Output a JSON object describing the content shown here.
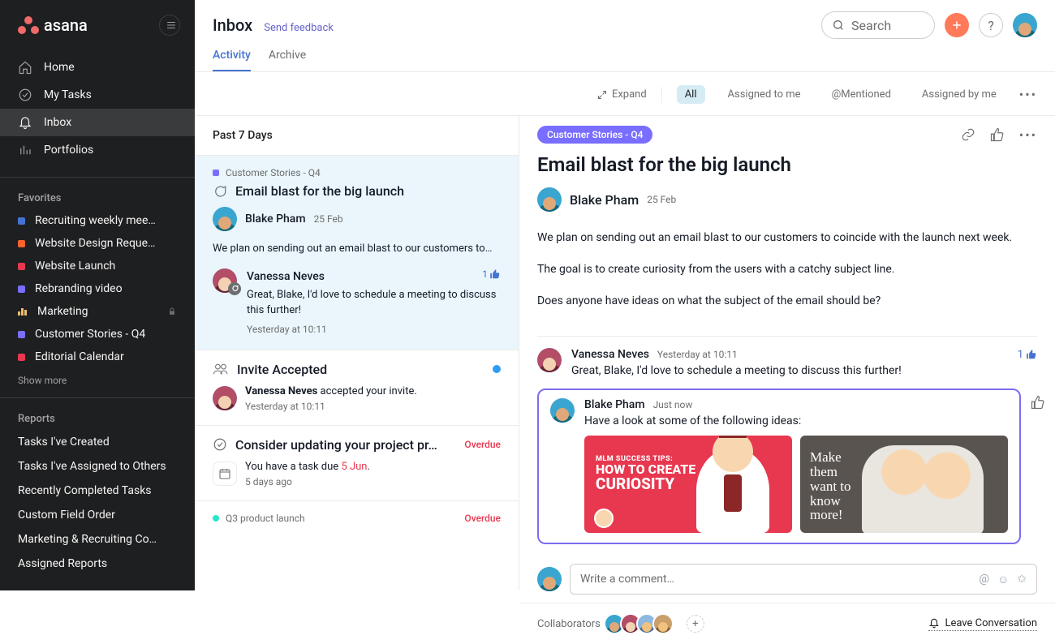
{
  "app": {
    "name": "asana"
  },
  "sidebar": {
    "nav": [
      {
        "label": "Home",
        "icon": "home-icon"
      },
      {
        "label": "My Tasks",
        "icon": "check-circle-icon"
      },
      {
        "label": "Inbox",
        "icon": "bell-icon",
        "active": true
      },
      {
        "label": "Portfolios",
        "icon": "bars-icon"
      }
    ],
    "favorites_title": "Favorites",
    "favorites": [
      {
        "label": "Recruiting weekly mee…",
        "color": "#4573d2"
      },
      {
        "label": "Website Design Reque…",
        "color": "#fd612c"
      },
      {
        "label": "Website Launch",
        "color": "#e8384f"
      },
      {
        "label": "Rebranding video",
        "color": "#796eff"
      },
      {
        "label": "Marketing",
        "icon": "bars",
        "locked": true
      },
      {
        "label": "Customer Stories - Q4",
        "color": "#796eff"
      },
      {
        "label": "Editorial Calendar",
        "color": "#e8384f"
      }
    ],
    "show_more": "Show more",
    "reports_title": "Reports",
    "reports": [
      "Tasks I've Created",
      "Tasks I've Assigned to Others",
      "Recently Completed Tasks",
      "Custom Field Order",
      "Marketing & Recruiting Co…",
      "Assigned Reports"
    ]
  },
  "header": {
    "title": "Inbox",
    "feedback": "Send feedback",
    "tabs": {
      "activity": "Activity",
      "archive": "Archive"
    },
    "search_placeholder": "Search"
  },
  "filters": {
    "expand": "Expand",
    "all": "All",
    "assigned_to_me": "Assigned to me",
    "mentioned": "@Mentioned",
    "assigned_by_me": "Assigned by me"
  },
  "list": {
    "section": "Past 7 Days",
    "items": [
      {
        "project": "Customer Stories - Q4",
        "project_color": "#796eff",
        "title": "Email blast for the big launch",
        "author": "Blake Pham",
        "date": "25 Feb",
        "excerpt": "We plan on sending out an email blast to our customers to…",
        "reply": {
          "author": "Vanessa Neves",
          "text": "Great, Blake, I'd love to schedule a meeting to discuss this further!",
          "time": "Yesterday at 10:11",
          "likes": "1"
        }
      },
      {
        "title": "Invite Accepted",
        "line": "Vanessa Neves accepted your invite.",
        "name_part": "Vanessa Neves",
        "rest_part": " accepted your invite.",
        "time": "Yesterday at 10:11",
        "unread": true
      },
      {
        "title": "Consider updating your project pr…",
        "status": "Overdue",
        "line_prefix": "You have a task due ",
        "due": "5 Jun",
        "suffix": ".",
        "time": "5 days ago"
      },
      {
        "project": "Q3 product launch",
        "project_color": "#25e8c8",
        "status": "Overdue"
      }
    ]
  },
  "detail": {
    "tag": "Customer Stories - Q4",
    "title": "Email blast for the big launch",
    "author": "Blake Pham",
    "date": "25 Feb",
    "paragraphs": [
      "We plan on sending out an email blast to our customers to coincide with the launch next week.",
      "The goal is to create curiosity from the users with a catchy subject line.",
      "Does anyone have ideas on what the subject of the email should be?"
    ],
    "comments": [
      {
        "author": "Vanessa Neves",
        "time": "Yesterday at 10:11",
        "text": "Great, Blake, I'd love to schedule a meeting to discuss this further!",
        "likes": "1"
      }
    ],
    "latest": {
      "author": "Blake Pham",
      "time": "Just now",
      "text": "Have a look at some of the following ideas:",
      "thumb1_line1": "MLM SUCCESS TIPS:",
      "thumb1_line2": "HOW TO CREATE",
      "thumb1_line3": "CURIOSITY",
      "thumb2_text": "Make\nthem\nwant to\nknow\nmore!"
    },
    "compose_placeholder": "Write a comment…",
    "collaborators_label": "Collaborators",
    "leave": "Leave Conversation"
  }
}
